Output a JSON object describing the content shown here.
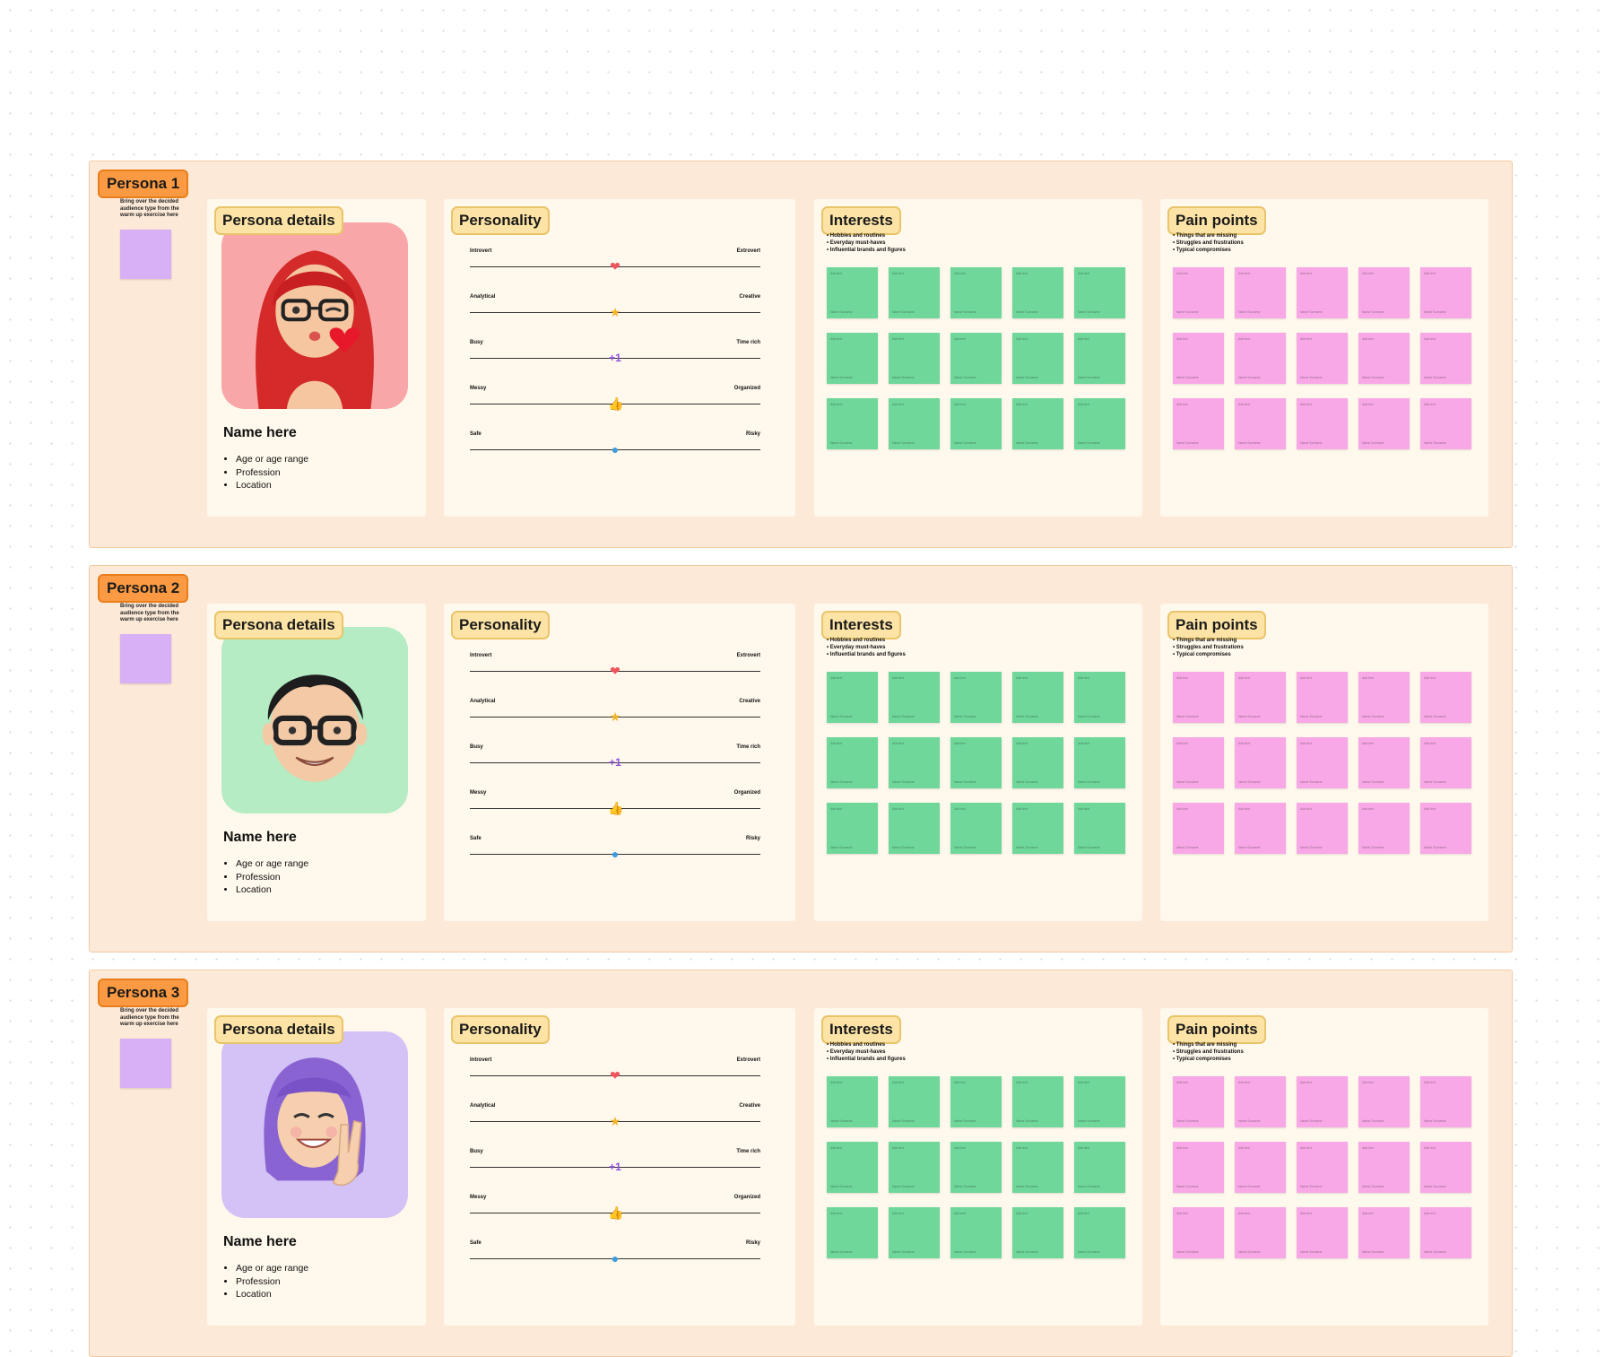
{
  "canvas": {
    "background": "#ffffff",
    "dot_color": "#d9d9d9"
  },
  "colors": {
    "section_bg": "#fde9d7",
    "persona_tag": "#fb9a42",
    "card_bg": "#fff8ec",
    "card_tag": "#fde4a6",
    "side_sticky": "#d7b0f5",
    "interest_sticky": "#6fd79a",
    "pain_sticky": "#f8a8e6",
    "avatar_backgrounds": [
      "#f8a6a8",
      "#b5ecc3",
      "#d2c2f5"
    ]
  },
  "personas": [
    {
      "tag": "Persona 1",
      "side_note": "Bring over the decided audience type from the warm up exercise here",
      "avatar": "memoji-red-hair-woman-winking-heart",
      "details": {
        "title": "Persona details",
        "name": "Name here",
        "items": [
          "Age or age range",
          "Profession",
          "Location"
        ]
      },
      "personality": {
        "title": "Personality"
      },
      "interests": {
        "title": "Interests",
        "bullets": [
          "• Hobbies and routines",
          "• Everyday must-haves",
          "• Influential brands and figures"
        ]
      },
      "pain_points": {
        "title": "Pain points",
        "bullets": [
          "• Things that are missing",
          "• Struggles and frustrations",
          "• Typical compromises"
        ]
      }
    },
    {
      "tag": "Persona 2",
      "side_note": "Bring over the decided audience type from the warm up exercise here",
      "avatar": "memoji-man-glasses-smiling",
      "details": {
        "title": "Persona details",
        "name": "Name here",
        "items": [
          "Age or age range",
          "Profession",
          "Location"
        ]
      },
      "personality": {
        "title": "Personality"
      },
      "interests": {
        "title": "Interests",
        "bullets": [
          "• Hobbies and routines",
          "• Everyday must-haves",
          "• Influential brands and figures"
        ]
      },
      "pain_points": {
        "title": "Pain points",
        "bullets": [
          "• Things that are missing",
          "• Struggles and frustrations",
          "• Typical compromises"
        ]
      }
    },
    {
      "tag": "Persona 3",
      "side_note": "Bring over the decided audience type from the warm up exercise here",
      "avatar": "memoji-purple-hair-peace-sign",
      "details": {
        "title": "Persona details",
        "name": "Name here",
        "items": [
          "Age or age range",
          "Profession",
          "Location"
        ]
      },
      "personality": {
        "title": "Personality"
      },
      "interests": {
        "title": "Interests",
        "bullets": [
          "• Hobbies and routines",
          "• Everyday must-haves",
          "• Influential brands and figures"
        ]
      },
      "pain_points": {
        "title": "Pain points",
        "bullets": [
          "• Things that are missing",
          "• Struggles and frustrations",
          "• Typical compromises"
        ]
      }
    }
  ],
  "sliders": [
    {
      "left": "Introvert",
      "right": "Extrovert",
      "marker": "heart-icon",
      "glyph": "❤",
      "color": "#f0545c",
      "value": 0.5
    },
    {
      "left": "Analytical",
      "right": "Creative",
      "marker": "star-icon",
      "glyph": "★",
      "color": "#f5b324",
      "value": 0.5
    },
    {
      "left": "Busy",
      "right": "Time rich",
      "marker": "plus-one-icon",
      "glyph": "+1",
      "color": "#8e4fe0",
      "value": 0.5
    },
    {
      "left": "Messy",
      "right": "Organized",
      "marker": "thumbs-up-icon",
      "glyph": "👍",
      "color": "#1b9a4a",
      "value": 0.5
    },
    {
      "left": "Safe",
      "right": "Risky",
      "marker": "circle-icon",
      "glyph": "●",
      "color": "#3d9be0",
      "value": 0.5
    }
  ],
  "sticky_text": {
    "top": "Add text",
    "bottom": "Name Surname"
  }
}
